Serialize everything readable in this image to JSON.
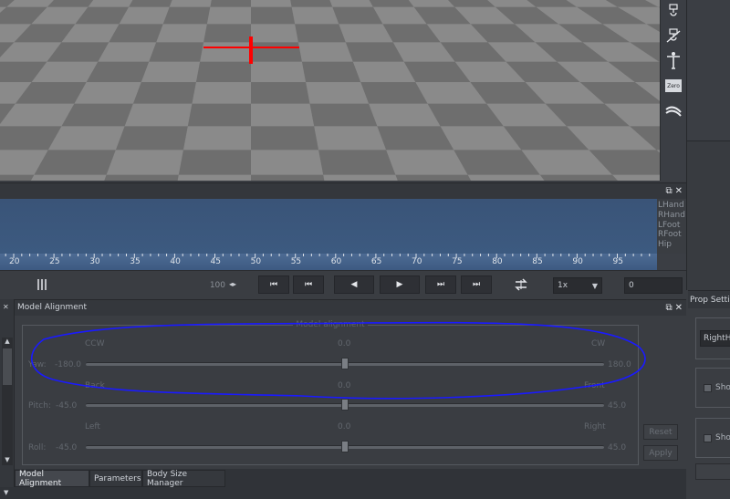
{
  "toolbar": {
    "icons": [
      "mocap-device-icon",
      "mocap-device-calibrate-icon",
      "t-pose-icon",
      "zero-icon",
      "foot-contact-icon"
    ],
    "zero_label": "Zero"
  },
  "timeline": {
    "bone_labels": [
      "LHand",
      "RHand",
      "LFoot",
      "RFoot",
      "Hip"
    ],
    "ruler_labels": [
      "20",
      "25",
      "30",
      "35",
      "40",
      "45",
      "50",
      "55",
      "60",
      "65",
      "70",
      "75",
      "80",
      "85",
      "90",
      "95"
    ]
  },
  "playback": {
    "end_frame": "100",
    "speed": "1x",
    "current_frame": "0"
  },
  "model_alignment": {
    "title": "Model Alignment",
    "group_title": "Model alignment",
    "yaw": {
      "label": "Yaw:",
      "min": "-180.0",
      "max": "180.0",
      "left_hint": "CCW",
      "right_hint": "CW",
      "value": "0.0"
    },
    "pitch": {
      "label": "Pitch:",
      "min": "-45.0",
      "max": "45.0",
      "left_hint": "Back",
      "right_hint": "Front",
      "value": "0.0"
    },
    "roll": {
      "label": "Roll:",
      "min": "-45.0",
      "max": "45.0",
      "left_hint": "Left",
      "right_hint": "Right",
      "value": "0.0"
    },
    "reset_label": "Reset",
    "apply_label": "Apply"
  },
  "tabs": [
    {
      "label": "Model Alignment",
      "active": true
    },
    {
      "label": "Parameters",
      "active": false
    },
    {
      "label": "Body Size Manager",
      "active": false
    }
  ],
  "prop_settings": {
    "title": "Prop Setti",
    "bone_value": "RightHa",
    "show_label_1": "Sho",
    "show_label_2": "Sho"
  },
  "colors": {
    "annotation": "#1a1aff",
    "origin_marker": "#ff0000",
    "timeline": "#3c5a80"
  }
}
